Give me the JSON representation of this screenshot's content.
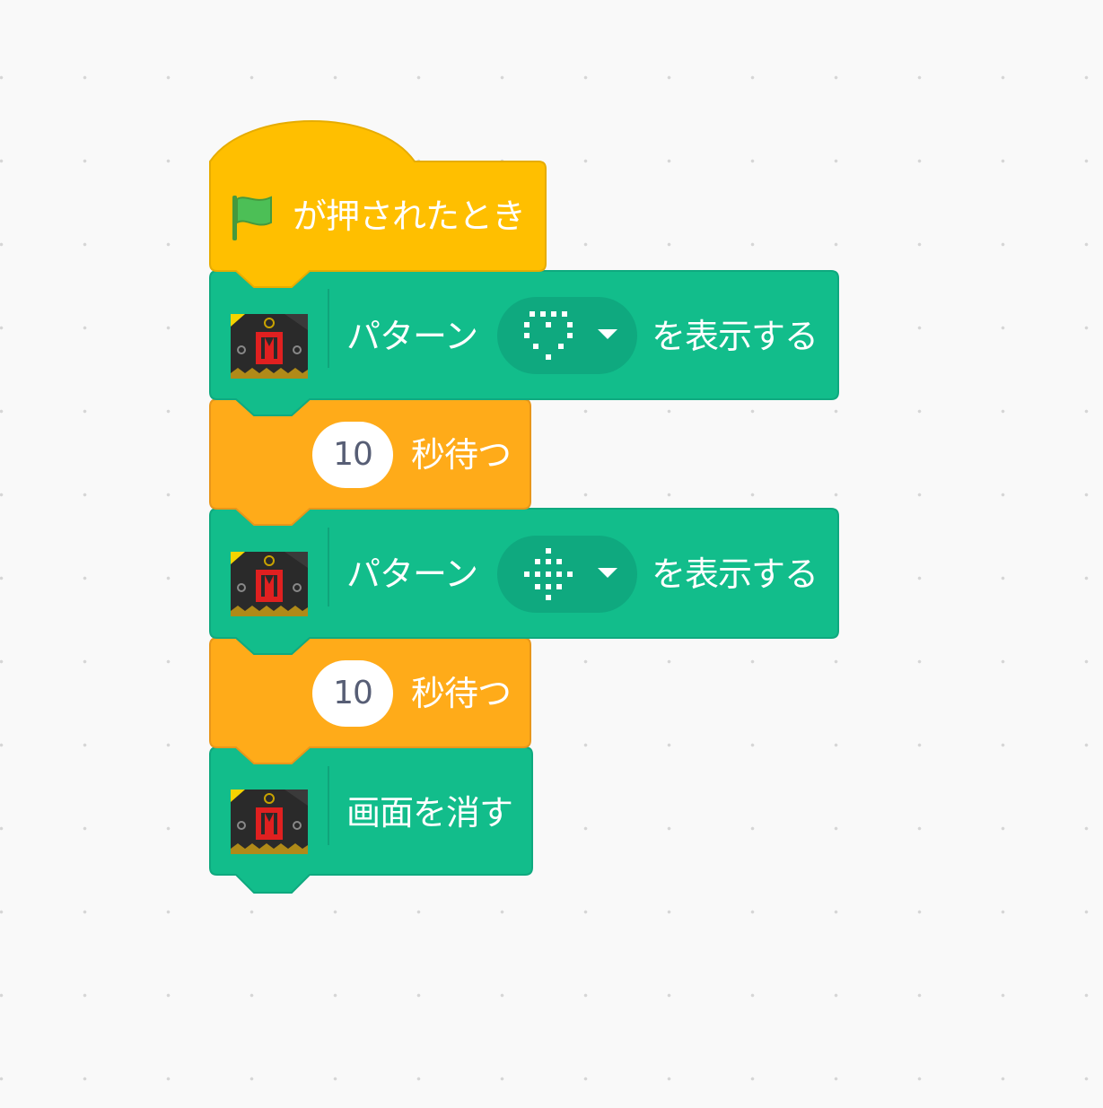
{
  "hat_block": {
    "icon": "green-flag-icon",
    "label": "が押されたとき",
    "color": "#ffbf00"
  },
  "extension": {
    "icon": "microbit-extension-icon",
    "color": "#12bd8b"
  },
  "control": {
    "color": "#ffab19"
  },
  "blocks": {
    "show_pattern_1": {
      "label_before": "パターン",
      "pattern_icon": "heart-outline-pattern",
      "label_after": "を表示する"
    },
    "wait_1": {
      "value": "10",
      "label": "秒待つ"
    },
    "show_pattern_2": {
      "label_before": "パターン",
      "pattern_icon": "diamond-grid-pattern",
      "label_after": "を表示する"
    },
    "wait_2": {
      "value": "10",
      "label": "秒待つ"
    },
    "clear_screen": {
      "label": "画面を消す"
    }
  }
}
